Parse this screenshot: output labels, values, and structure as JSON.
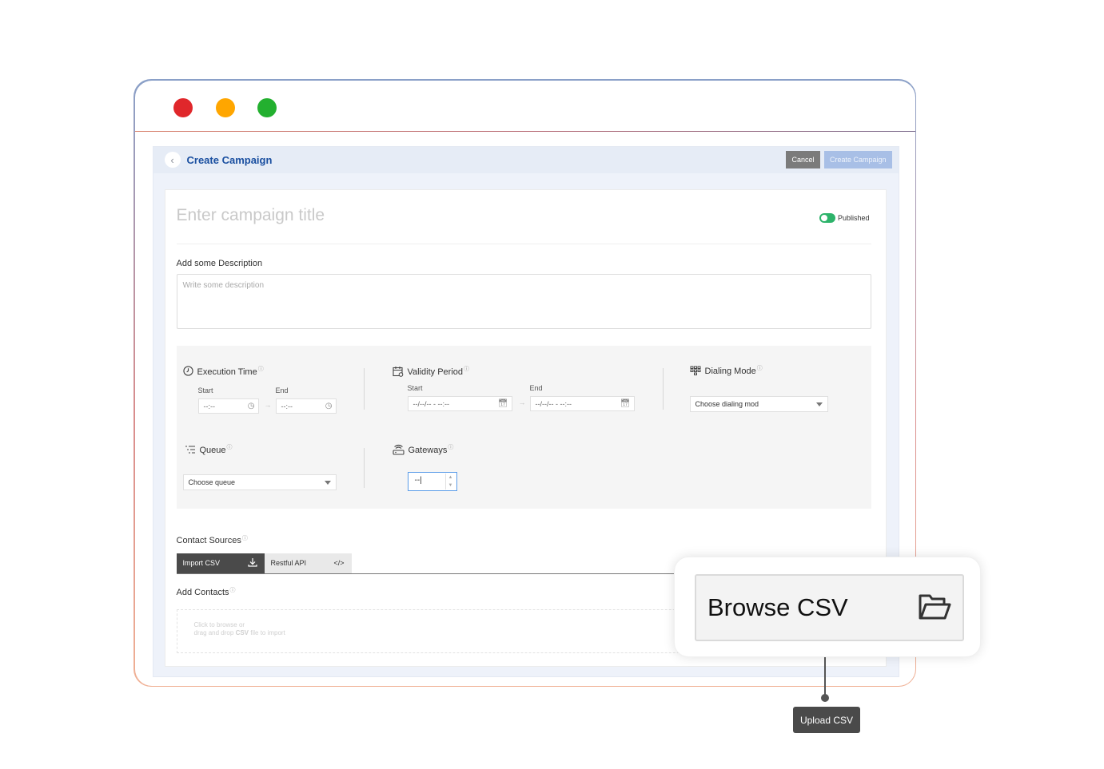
{
  "header": {
    "title": "Create Campaign",
    "cancel_label": "Cancel",
    "create_label": "Create Campaign",
    "back_icon": "chevron-left-icon"
  },
  "campaign": {
    "title_placeholder": "Enter campaign title",
    "status_label": "Published",
    "published": true,
    "description_label": "Add some Description",
    "description_placeholder": "Write some description"
  },
  "execution_time": {
    "label": "Execution Time",
    "start_label": "Start",
    "end_label": "End",
    "start_value": "--:--",
    "end_value": "--:--"
  },
  "validity_period": {
    "label": "Validity Period",
    "start_label": "Start",
    "end_label": "End",
    "start_value": "--/--/-- - --:--",
    "end_value": "--/--/-- - --:--"
  },
  "dialing_mode": {
    "label": "Dialing Mode",
    "selected": "Choose dialing mod"
  },
  "queue": {
    "label": "Queue",
    "selected": "Choose queue"
  },
  "gateways": {
    "label": "Gateways",
    "value": "--"
  },
  "contact_sources": {
    "label": "Contact Sources",
    "tabs": [
      {
        "label": "Import CSV",
        "icon": "download-icon",
        "active": true
      },
      {
        "label": "Restful API",
        "icon": "code-icon",
        "active": false
      }
    ]
  },
  "add_contacts": {
    "label": "Add Contacts",
    "drop_line1": "Click to browse or",
    "drop_prefix": "drag and drop",
    "drop_bold": "CSV",
    "drop_suffix": "file to import"
  },
  "callout": {
    "browse_label": "Browse CSV",
    "icon": "folder-open-icon",
    "tooltip": "Upload CSV"
  },
  "colors": {
    "accent": "#1a4fa0",
    "toggle_on": "#2db36a",
    "window_red": "#e0272b",
    "window_yellow": "#ffa600",
    "window_green": "#23b02f"
  }
}
